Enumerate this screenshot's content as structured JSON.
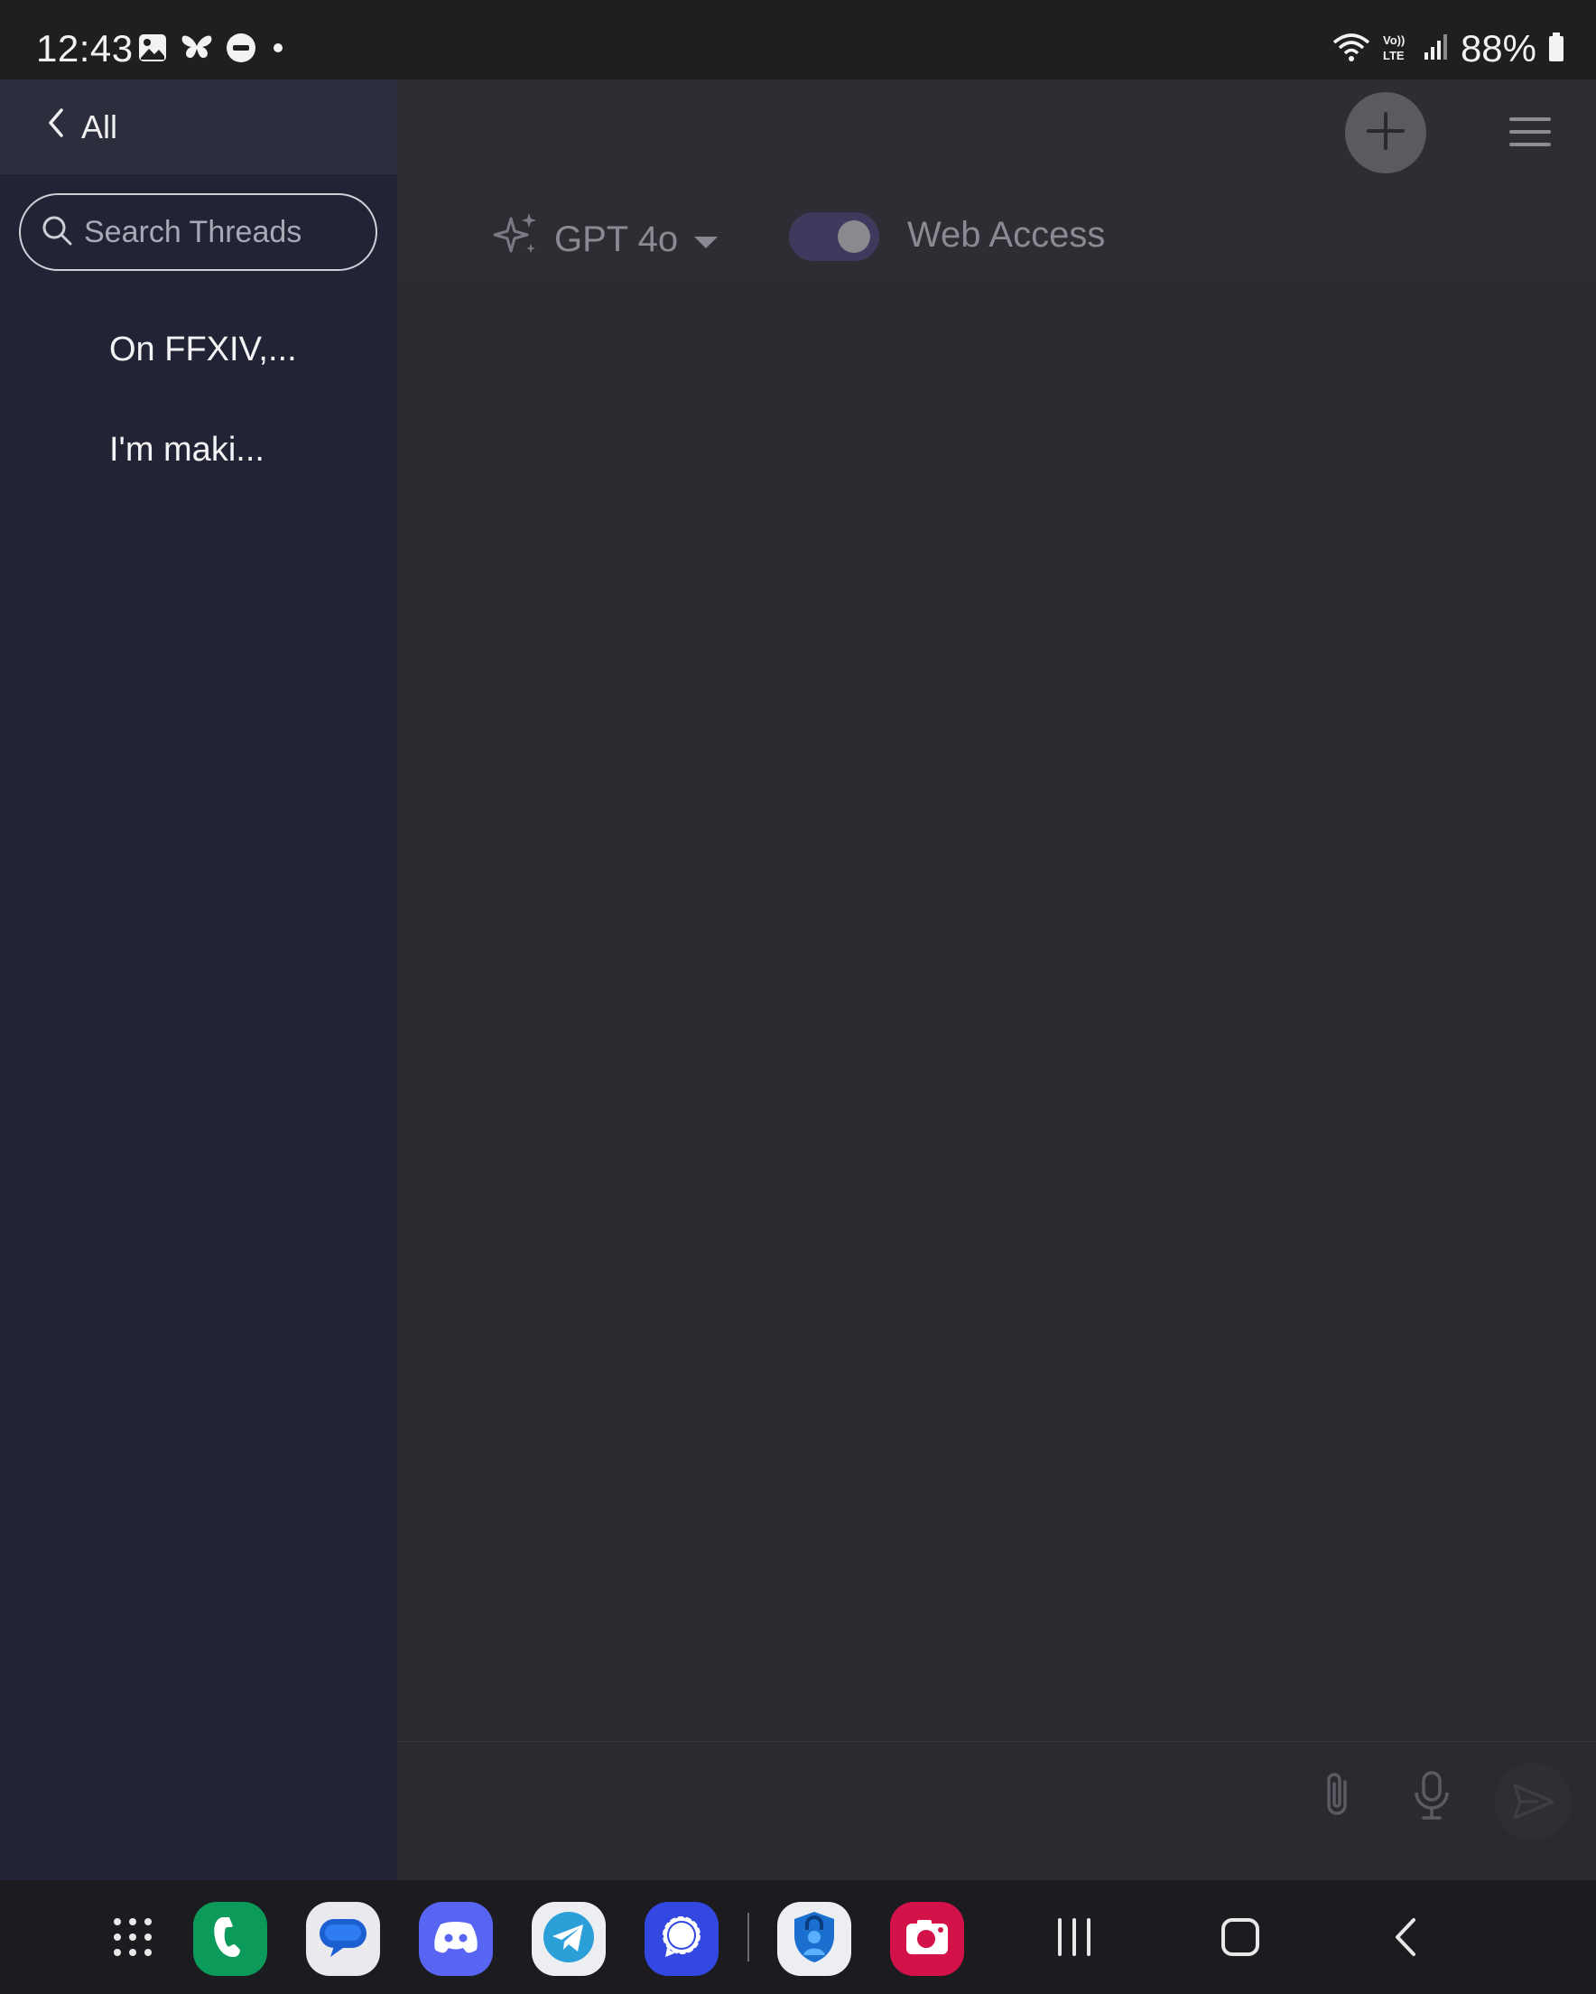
{
  "status_bar": {
    "time": "12:43",
    "battery": "88%",
    "left_icons": [
      "gallery-icon",
      "butterfly-icon",
      "do-not-disturb-icon",
      "dot-icon"
    ],
    "right_icons": [
      "wifi-icon",
      "volte-icon",
      "signal-icon",
      "battery-icon"
    ]
  },
  "sidebar": {
    "back_label": "All",
    "search_placeholder": "Search Threads",
    "threads": [
      {
        "title": "On FFXIV,..."
      },
      {
        "title": "I'm maki..."
      }
    ]
  },
  "header": {
    "model": "GPT 4o",
    "web_access_label": "Web Access",
    "web_access_enabled": true
  },
  "composer": {
    "actions": [
      "attach-icon",
      "microphone-icon",
      "send-icon"
    ]
  },
  "dock": {
    "apps": [
      "app-drawer",
      "phone",
      "messages",
      "discord",
      "telegram",
      "signal",
      "authenticator",
      "camera-app"
    ],
    "nav": [
      "recents",
      "home",
      "back"
    ]
  },
  "colors": {
    "sidebar_bg": "#222436",
    "main_bg": "#2b2a30",
    "toggle_track": "#3d3a5e"
  }
}
